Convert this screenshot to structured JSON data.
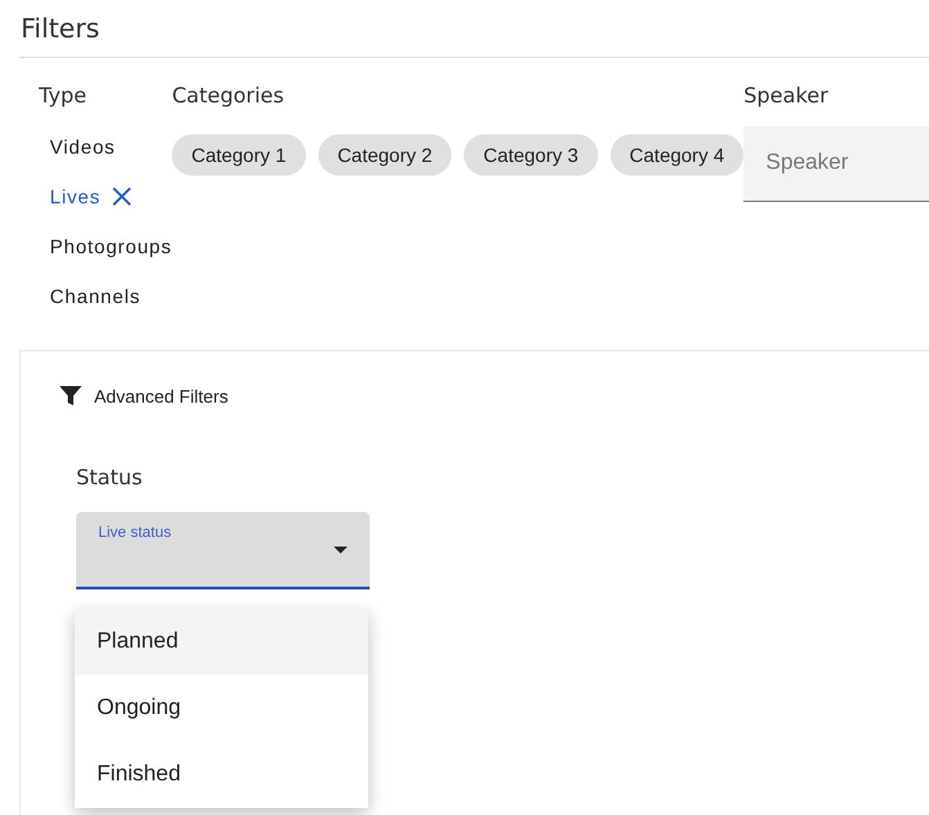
{
  "title": "Filters",
  "type": {
    "label": "Type",
    "items": [
      {
        "label": "Videos",
        "selected": false
      },
      {
        "label": "Lives",
        "selected": true
      },
      {
        "label": "Photogroups",
        "selected": false
      },
      {
        "label": "Channels",
        "selected": false
      }
    ]
  },
  "categories": {
    "label": "Categories",
    "chips": [
      "Category 1",
      "Category 2",
      "Category 3",
      "Category 4"
    ]
  },
  "speaker": {
    "label": "Speaker",
    "placeholder": "Speaker"
  },
  "advanced": {
    "title": "Advanced Filters",
    "status": {
      "label": "Status",
      "field_label": "Live status",
      "expanded": true,
      "options": [
        {
          "label": "Planned",
          "selected": true
        },
        {
          "label": "Ongoing",
          "selected": false
        },
        {
          "label": "Finished",
          "selected": false
        }
      ]
    }
  }
}
